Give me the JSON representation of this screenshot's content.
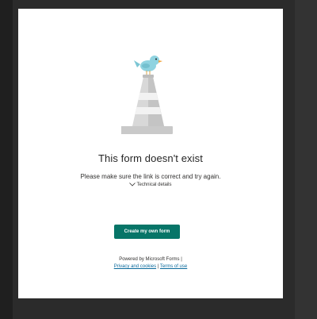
{
  "error": {
    "title": "This form doesn't exist",
    "message": "Please make sure the link is correct and try again.",
    "details_toggle": "Technical details"
  },
  "actions": {
    "create_label": "Create my own form"
  },
  "footer": {
    "powered_by": "Powered by Microsoft Forms |",
    "privacy_link": "Privacy and cookies",
    "separator": "|",
    "terms_link": "Terms of use"
  },
  "colors": {
    "background": "#2b2b2b",
    "card": "#ffffff",
    "button": "#077568",
    "link": "#0b6a9c",
    "bird": "#8fd3e0",
    "cone": "#c8c8c8"
  },
  "icons": {
    "illustration": "traffic-cone-with-bird-icon",
    "chevron": "chevron-down-icon"
  }
}
